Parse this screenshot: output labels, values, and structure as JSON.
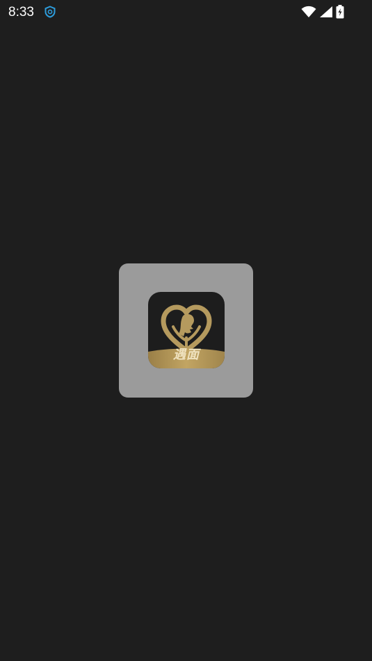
{
  "status_bar": {
    "time": "8:33",
    "notification_icon": "security-shield-icon",
    "icons": [
      "wifi-icon",
      "cellular-signal-icon",
      "battery-charging-icon"
    ]
  },
  "splash": {
    "logo_icon": "heart-logo-icon",
    "logo_text": "遇面"
  },
  "colors": {
    "background": "#1e1e1e",
    "card": "#9b9b9b",
    "logo_bg": "#1d1d1d",
    "logo_gold": "#b59a5e",
    "status_accent": "#2d9cdb"
  }
}
